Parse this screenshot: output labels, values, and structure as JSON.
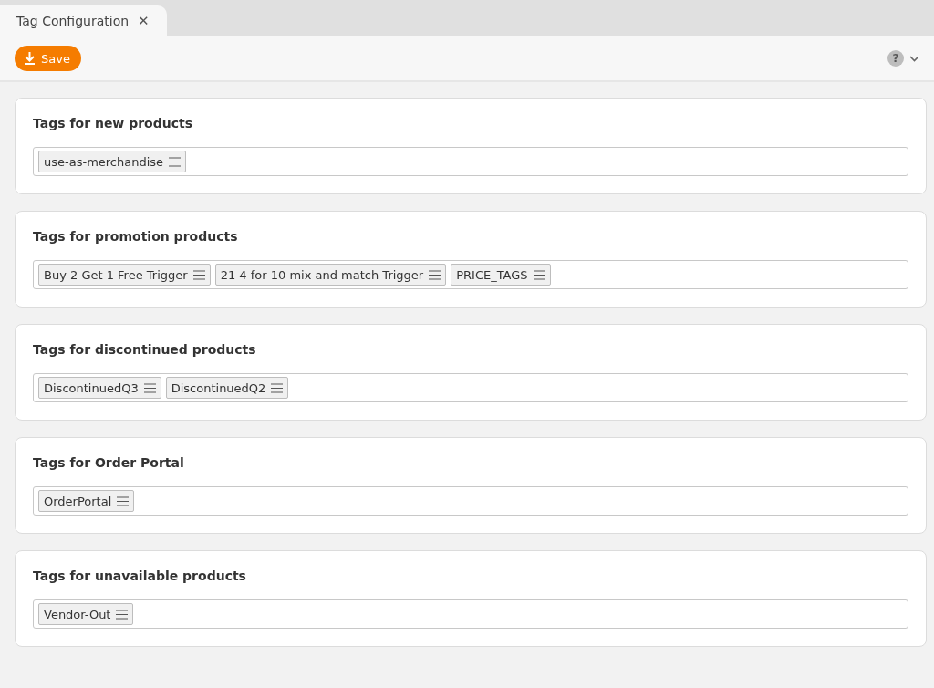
{
  "tab": {
    "title": "Tag Configuration",
    "close": "✕"
  },
  "toolbar": {
    "save": "Save",
    "help": "?"
  },
  "sections": [
    {
      "title": "Tags for new products",
      "tags": [
        "use-as-merchandise"
      ]
    },
    {
      "title": "Tags for promotion products",
      "tags": [
        "Buy 2 Get 1 Free Trigger",
        "21 4 for 10 mix and match Trigger",
        "PRICE_TAGS"
      ]
    },
    {
      "title": "Tags for discontinued products",
      "tags": [
        "DiscontinuedQ3",
        "DiscontinuedQ2"
      ]
    },
    {
      "title": "Tags for Order Portal",
      "tags": [
        "OrderPortal"
      ]
    },
    {
      "title": "Tags for unavailable products",
      "tags": [
        "Vendor-Out"
      ]
    }
  ]
}
